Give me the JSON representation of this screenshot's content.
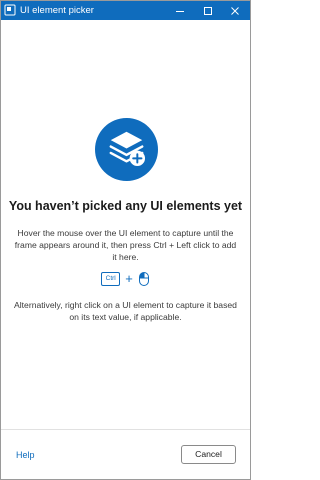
{
  "window": {
    "title": "UI element picker",
    "accent": "#0f6cbd"
  },
  "titlebar_icons": {
    "app": "ui-picker-icon",
    "minimize": "minimize-icon",
    "maximize": "maximize-icon",
    "close": "close-icon"
  },
  "empty_state": {
    "illustration": "layers-add-icon",
    "heading": "You haven’t picked any UI elements yet",
    "instructions": "Hover the mouse over the UI element to capture until the frame appears around it, then press Ctrl + Left click to add it here.",
    "shortcut": {
      "key_label": "Ctrl",
      "plus": "+",
      "mouse_icon": "mouse-left-click-icon"
    },
    "alternative": "Alternatively, right click on a UI element to capture it based on its text value, if applicable."
  },
  "footer": {
    "help_label": "Help",
    "cancel_label": "Cancel"
  }
}
